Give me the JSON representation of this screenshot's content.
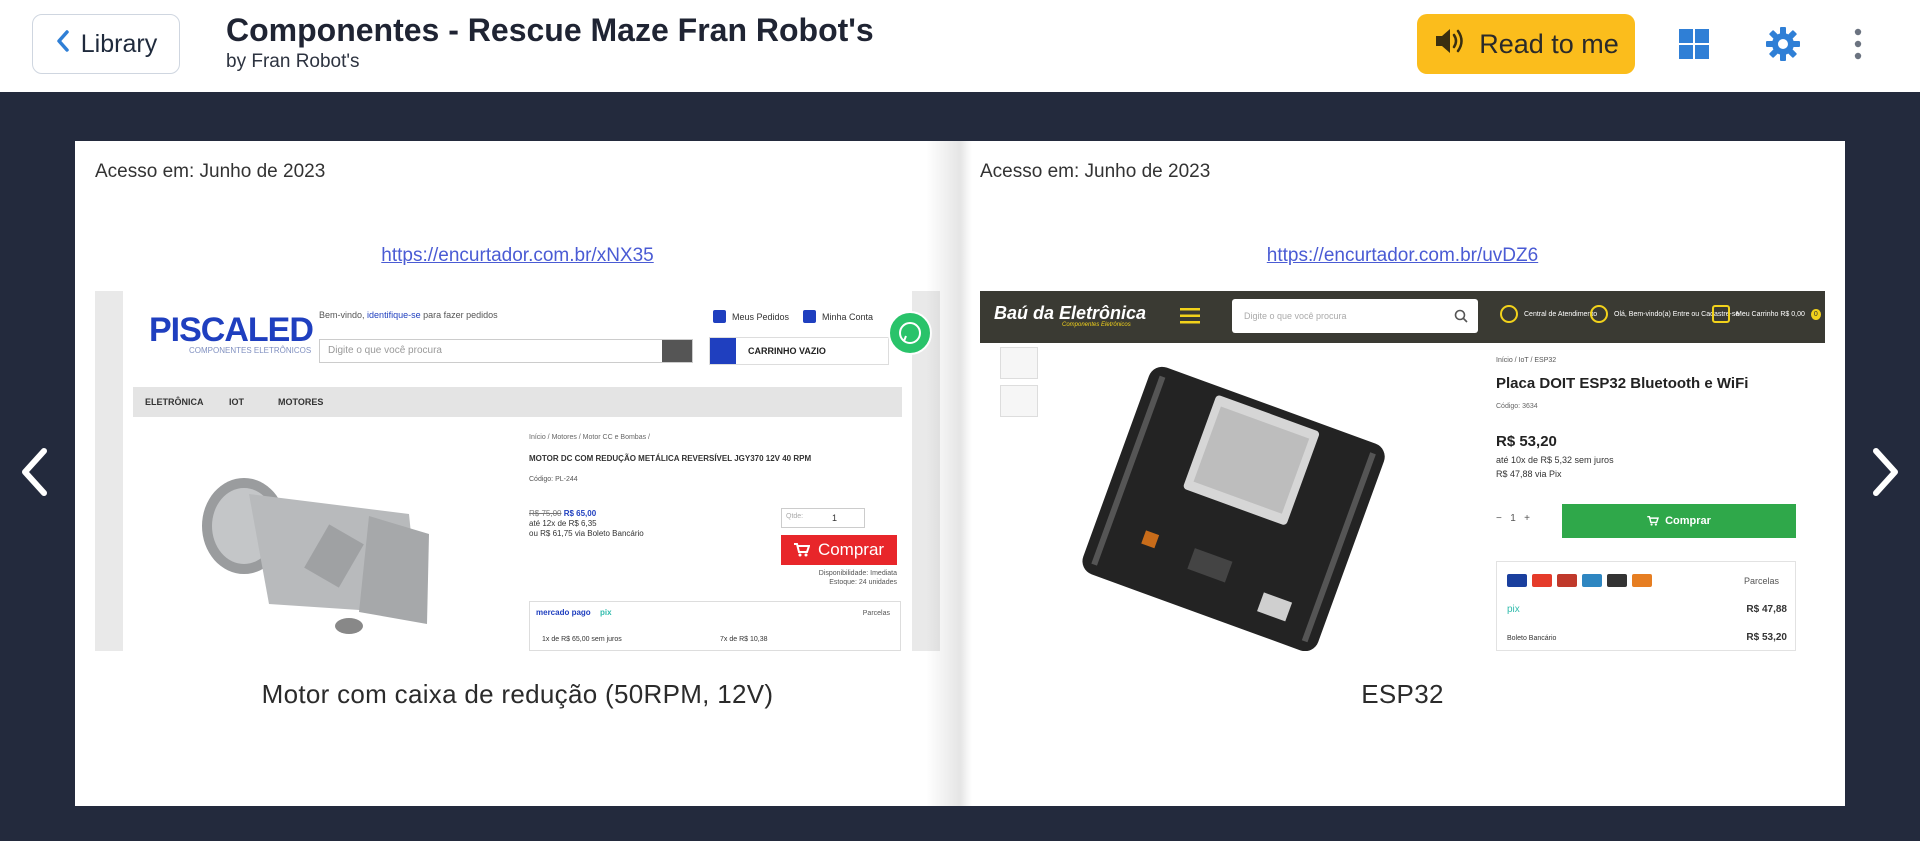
{
  "header": {
    "back_label": "Library",
    "title": "Componentes - Rescue Maze Fran Robot's",
    "author": "by Fran Robot's",
    "read_label": "Read to me"
  },
  "colors": {
    "read_button": "#fbbd1c",
    "icon_blue": "#2f7fd6",
    "stage_bg": "#232a3d",
    "link": "#4a5bd4"
  },
  "icons": [
    "chevron-left-icon",
    "speaker-icon",
    "grid-layout-icon",
    "gear-icon",
    "more-vertical-icon",
    "arrow-left-icon",
    "arrow-right-icon"
  ],
  "pages": {
    "left": {
      "access": "Acesso em: Junho de 2023",
      "link": "https://encurtador.com.br/xNX35",
      "caption": "Motor com caixa de redução (50RPM, 12V)",
      "shot": {
        "logo": "PISCALED",
        "logo_sub": "COMPONENTES ELETRÔNICOS",
        "welcome_pre": "Bem-vindo,",
        "welcome_link": "identifique-se",
        "welcome_post": "para fazer pedidos",
        "search_placeholder": "Digite o que você procura",
        "orders": "Meus Pedidos",
        "account": "Minha Conta",
        "cart": "CARRINHO VAZIO",
        "menu": [
          "ELETRÔNICA",
          "IOT",
          "MOTORES"
        ],
        "breadcrumb": "Início / Motores / Motor CC e Bombas /",
        "product_title": "MOTOR DC COM REDUÇÃO METÁLICA REVERSÍVEL JGY370 12V 40 RPM",
        "code": "Código: PL-244",
        "old_price": "R$ 75,00",
        "price": "R$ 65,00",
        "installments": "até 12x de R$ 6,35",
        "boleto": "ou R$ 61,75 via Boleto Bancário",
        "qty_label": "Qtde:",
        "qty": "1",
        "buy": "Comprar",
        "availability": "Disponibilidade: Imediata",
        "stock": "Estoque: 24 unidades",
        "pay_brand": "mercado pago",
        "pay_pix": "pix",
        "parcelas": "Parcelas",
        "pay_row1": "1x de R$ 65,00 sem juros",
        "pay_row2": "7x de R$ 10,38"
      }
    },
    "right": {
      "access": "Acesso em: Junho de 2023",
      "link": "https://encurtador.com.br/uvDZ6",
      "caption": "ESP32",
      "shot": {
        "logo": "Baú da Eletrônica",
        "logo_sub": "Componentes Eletrônicos",
        "search_placeholder": "Digite o que você procura",
        "service": "Central de Atendimento",
        "greeting": "Olá, Bem-vindo(a) Entre ou Cadastre-se",
        "cart": "Meu Carrinho R$ 0,00",
        "cart_count": "0",
        "breadcrumb": "Início / IoT / ESP32",
        "product_title": "Placa DOIT ESP32 Bluetooth e WiFi",
        "code": "Código: 3634",
        "price": "R$ 53,20",
        "installments": "até 10x de R$ 5,32 sem juros",
        "pix_price": "R$ 47,88 via Pix",
        "qty": "1",
        "buy": "Comprar",
        "parcelas": "Parcelas",
        "pix_label": "pix",
        "pix_value": "R$ 47,88",
        "boleto_label": "Boleto Bancário",
        "boleto_value": "R$ 53,20"
      }
    }
  }
}
